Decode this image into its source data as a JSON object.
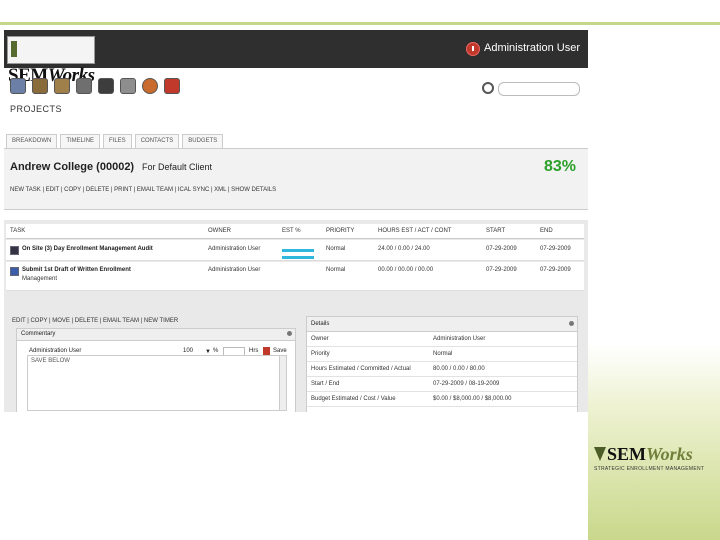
{
  "app": {
    "logo_text": "SEM",
    "logo_text_italic": "Works",
    "user_name": "Administration User",
    "page_title": "PROJECTS"
  },
  "toolbar_icons": [
    "calendar-icon",
    "folder-icon",
    "box-icon",
    "grid-icon",
    "briefcase-icon",
    "sync-icon",
    "target-icon",
    "tools-icon"
  ],
  "tabs": [
    "BREAKDOWN",
    "TIMELINE",
    "FILES",
    "CONTACTS",
    "BUDGETS"
  ],
  "project": {
    "name": "Andrew College (00002)",
    "client": "For Default Client",
    "percent": "83%",
    "actions": "NEW TASK | EDIT | COPY | DELETE | PRINT | EMAIL TEAM | ICAL SYNC | XML | SHOW DETAILS",
    "percent_color": "#2aa02a"
  },
  "grid": {
    "columns": [
      "TASK",
      "OWNER",
      "EST %",
      "PRIORITY",
      "HOURS EST / ACT / CONT",
      "START",
      "END"
    ],
    "rows": [
      {
        "task": "On Site (3) Day Enrollment Management Audit",
        "owner": "Administration User",
        "priority": "Normal",
        "hours": "24.00 / 0.00 / 24.00",
        "start": "07-29-2009",
        "end": "07-29-2009",
        "progress": 1.0
      },
      {
        "task": "Submit 1st Draft of Written Enrollment",
        "task_line2": "Management",
        "owner": "Administration User",
        "priority": "Normal",
        "hours": "00.00 / 00.00 / 00.00",
        "start": "07-29-2009",
        "end": "07-29-2009",
        "progress": 1.0
      }
    ],
    "row_actions": "EDIT | COPY | MOVE | DELETE | EMAIL TEAM | NEW TIMER"
  },
  "commentary": {
    "title": "Commentary",
    "user_select": "Administration User",
    "percent_value": "100",
    "percent_symbol": "%",
    "hours_label": "Hrs",
    "save_label": "Save",
    "placeholder": "SAVE BELOW"
  },
  "details": {
    "title": "Details",
    "rows": [
      {
        "k": "Owner",
        "v": "Administration User"
      },
      {
        "k": "Priority",
        "v": "Normal"
      },
      {
        "k": "Hours Estimated / Committed / Actual",
        "v": "80.00 / 0.00 / 80.00"
      },
      {
        "k": "Start / End",
        "v": "07-29-2009 / 08-19-2009"
      },
      {
        "k": "Budget Estimated / Cost / Value",
        "v": "$0.00 / $8,000.00 / $8,000.00"
      }
    ]
  },
  "brand": {
    "logo_text": "SEM",
    "logo_text_italic": "Works",
    "tagline": "STRATEGIC ENROLLMENT MANAGEMENT"
  }
}
